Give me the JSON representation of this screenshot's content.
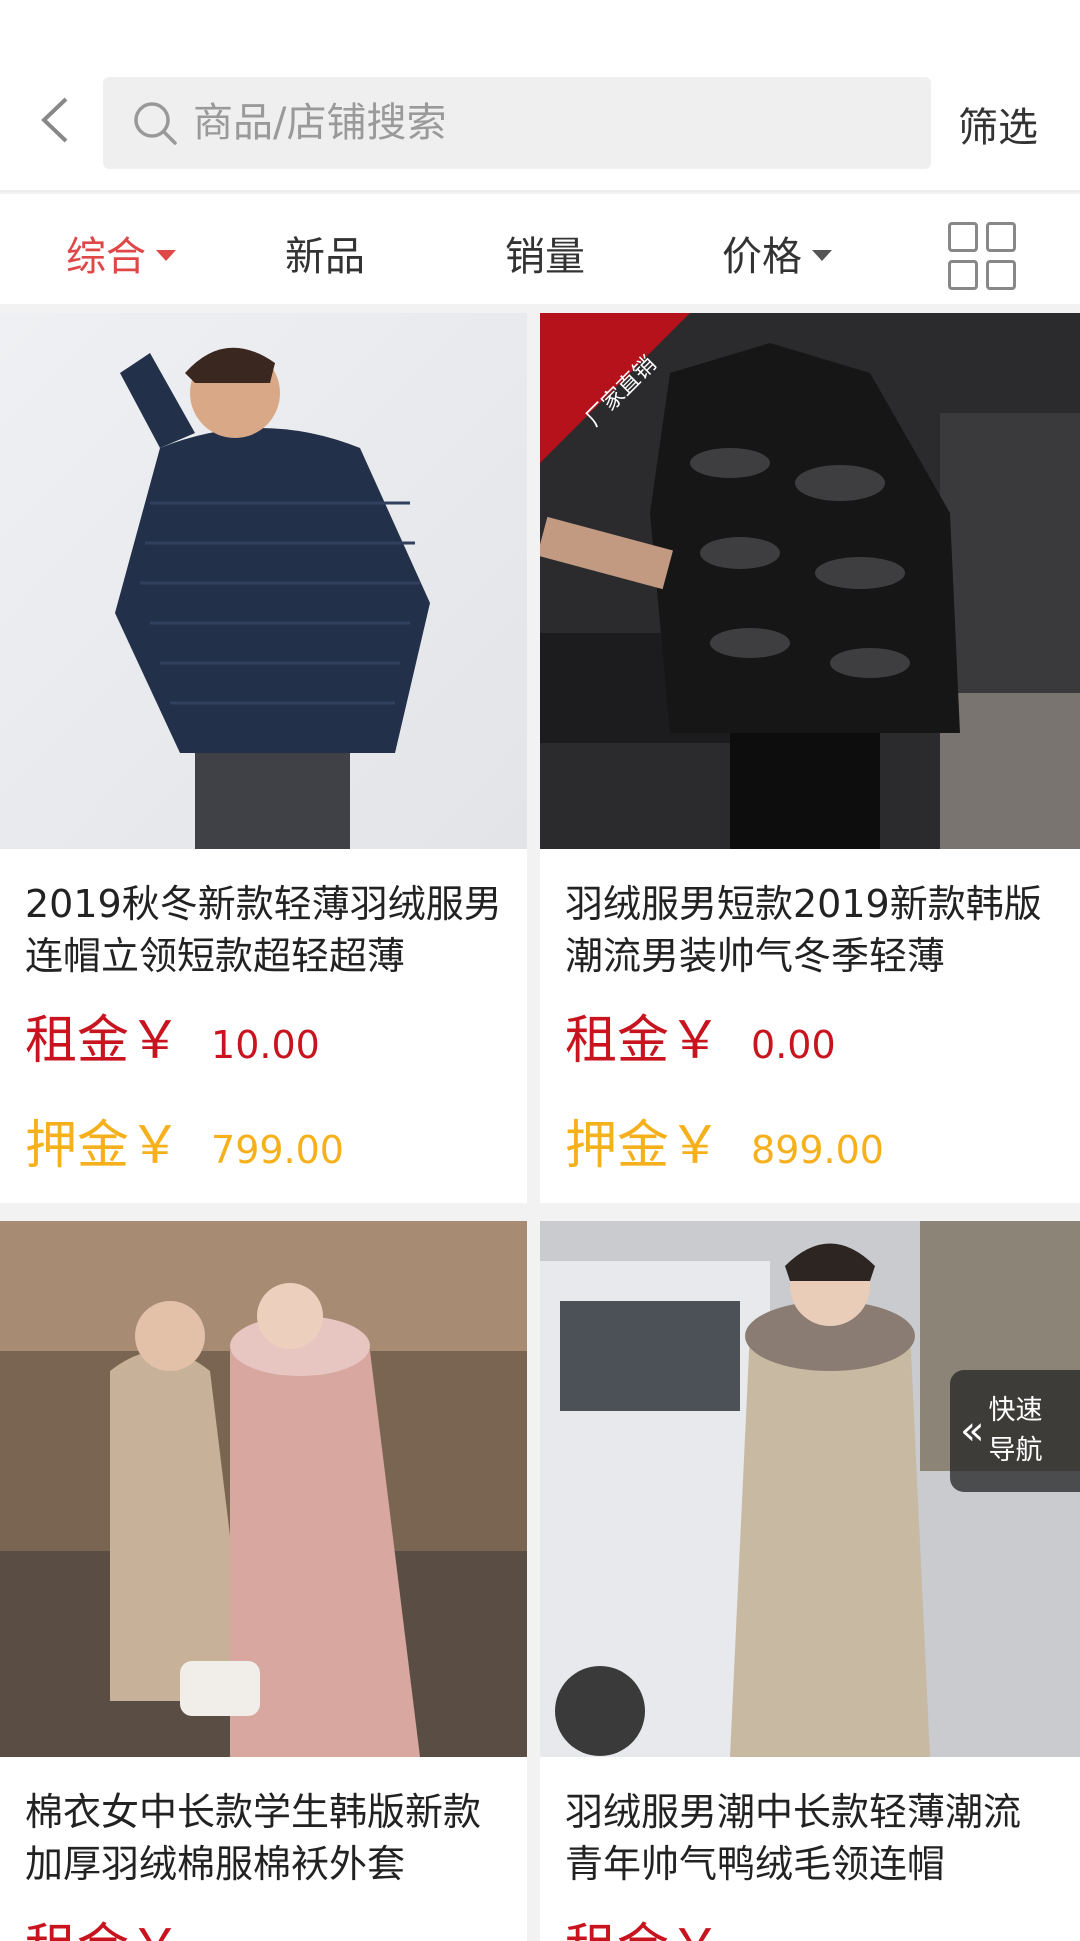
{
  "search": {
    "placeholder": "商品/店铺搜索"
  },
  "header": {
    "filter_label": "筛选"
  },
  "sort_tabs": [
    {
      "label": "综合",
      "active": true,
      "has_caret": true
    },
    {
      "label": "新品",
      "active": false,
      "has_caret": false
    },
    {
      "label": "销量",
      "active": false,
      "has_caret": false
    },
    {
      "label": "价格",
      "active": false,
      "has_caret": true
    }
  ],
  "products": [
    {
      "title": "2019秋冬新款轻薄羽绒服男连帽立领短款超轻超薄",
      "rent_label": "租金￥",
      "rent_value": "10.00",
      "deposit_label": "押金￥",
      "deposit_value": "799.00"
    },
    {
      "title": "羽绒服男短款2019新款韩版潮流男装帅气冬季轻薄",
      "rent_label": "租金￥",
      "rent_value": "0.00",
      "deposit_label": "押金￥",
      "deposit_value": "899.00",
      "ribbon": "厂家直销"
    },
    {
      "title": "棉衣女中长款学生韩版新款加厚羽绒棉服棉袄外套",
      "rent_label": "租金￥"
    },
    {
      "title": "羽绒服男潮中长款轻薄潮流青年帅气鸭绒毛领连帽",
      "rent_label": "租金￥"
    }
  ],
  "quick_nav": {
    "line1": "快速",
    "line2": "导航"
  },
  "colors": {
    "accent_red": "#e04848",
    "rent_red": "#c8141e",
    "deposit_orange": "#f5b01c"
  }
}
